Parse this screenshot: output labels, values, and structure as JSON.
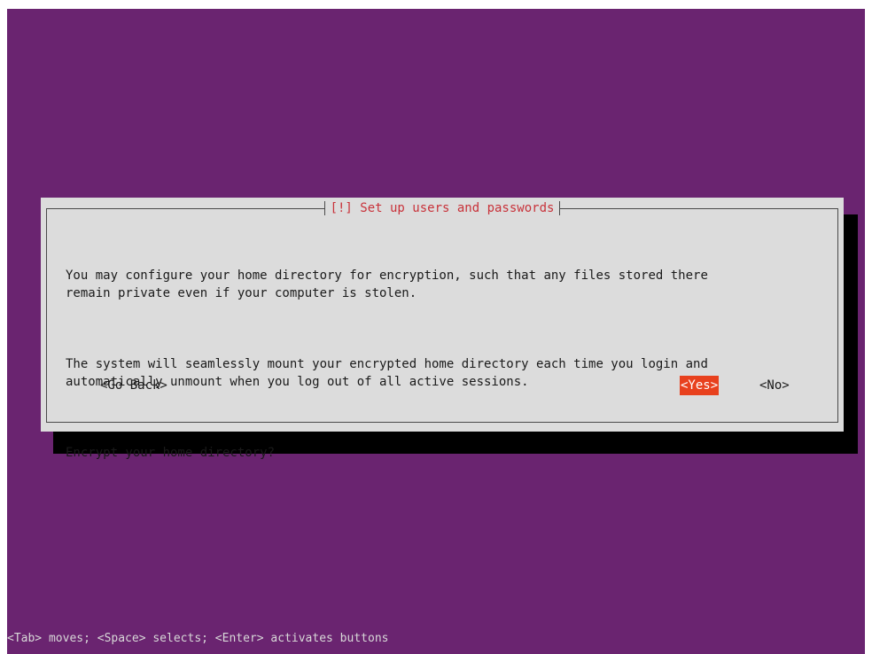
{
  "dialog": {
    "title": "[!] Set up users and passwords",
    "paragraphs": [
      "You may configure your home directory for encryption, such that any files stored there\nremain private even if your computer is stolen.",
      "The system will seamlessly mount your encrypted home directory each time you login and\nautomatically unmount when you log out of all active sessions.",
      "Encrypt your home directory?"
    ],
    "buttons": {
      "go_back": "<Go Back>",
      "yes": "<Yes>",
      "no": "<No>"
    },
    "selected_button": "yes"
  },
  "status_bar": {
    "hint": "<Tab> moves; <Space> selects; <Enter> activates buttons"
  },
  "colors": {
    "background": "#6a2470",
    "dialog": "#dcdcdc",
    "shadow": "#000000",
    "title_text": "#c8323a",
    "selected_button": "#e8411e"
  }
}
